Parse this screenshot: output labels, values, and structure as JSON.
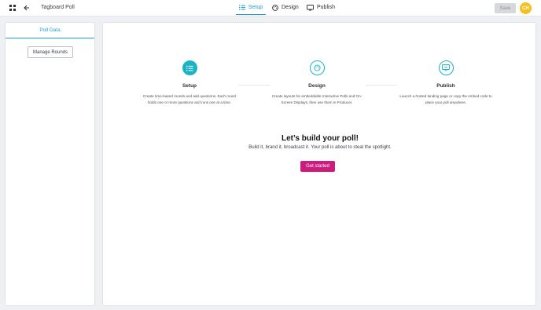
{
  "header": {
    "app_title": "Tagboard Poll",
    "tabs": [
      {
        "label": "Setup",
        "icon": "list-icon",
        "active": true
      },
      {
        "label": "Design",
        "icon": "palette-icon",
        "active": false
      },
      {
        "label": "Publish",
        "icon": "monitor-icon",
        "active": false
      }
    ],
    "save_label": "Save",
    "avatar_initials": "CH"
  },
  "sidebar": {
    "tab_label": "Poll Data",
    "manage_rounds_label": "Manage Rounds"
  },
  "main": {
    "steps": [
      {
        "title": "Setup",
        "description": "Create time-based rounds and add questions. Each round holds one or more questions and runs one at a time.",
        "icon": "list-icon"
      },
      {
        "title": "Design",
        "description": "Create layouts for embeddable Interactive Polls and On-Screen Displays, then use them in Producer.",
        "icon": "palette-icon"
      },
      {
        "title": "Publish",
        "description": "Launch a hosted landing page or copy the embed code to place your poll anywhere.",
        "icon": "monitor-icon"
      }
    ],
    "headline": "Let’s build your poll!",
    "subline": "Build it, brand it, broadcast it. Your poll is about to steal the spotlight.",
    "cta_label": "Get started"
  },
  "colors": {
    "accent": "#1f9bd7",
    "teal": "#19b3c6",
    "cta": "#cc1d7f",
    "avatar": "#f4c01e"
  }
}
